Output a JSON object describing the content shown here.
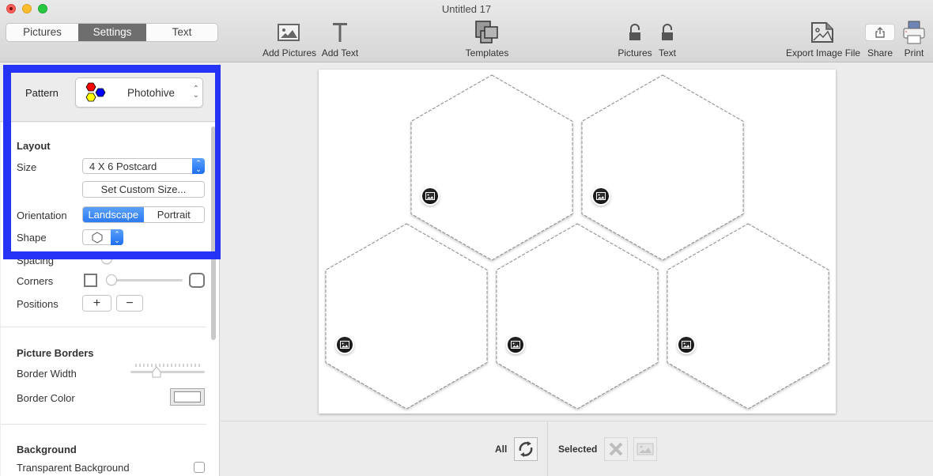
{
  "window": {
    "title": "Untitled 17"
  },
  "mode_tabs": [
    {
      "label": "Pictures",
      "active": false
    },
    {
      "label": "Settings",
      "active": true
    },
    {
      "label": "Text",
      "active": false
    }
  ],
  "toolbar": {
    "add_pictures": "Add Pictures",
    "add_text": "Add Text",
    "templates": "Templates",
    "lock_pictures": "Pictures",
    "lock_text": "Text",
    "export": "Export Image File",
    "share": "Share",
    "print": "Print"
  },
  "sidebar": {
    "pattern": {
      "label": "Pattern",
      "value": "Photohive",
      "icon_colors": [
        "#ff0000",
        "#ffff00",
        "#0000ff"
      ]
    },
    "layout": {
      "title": "Layout",
      "size_label": "Size",
      "size_value": "4 X 6 Postcard",
      "custom_size_button": "Set Custom Size...",
      "orientation_label": "Orientation",
      "orientation_options": [
        "Landscape",
        "Portrait"
      ],
      "orientation_selected": "Landscape",
      "shape_label": "Shape",
      "shape_value": "hexagon",
      "spacing_label": "Spacing",
      "corners_label": "Corners",
      "corners_value": 0,
      "positions_label": "Positions",
      "positions_add": "+",
      "positions_remove": "−"
    },
    "picture_borders": {
      "title": "Picture Borders",
      "border_width_label": "Border Width",
      "border_width_value": 0.25,
      "border_color_label": "Border Color",
      "border_color": "#ffffff"
    },
    "background": {
      "title": "Background",
      "transparent_label": "Transparent Background",
      "transparent_checked": false
    }
  },
  "canvas": {
    "cells": [
      {
        "id": 1,
        "row": 1
      },
      {
        "id": 2,
        "row": 1
      },
      {
        "id": 3,
        "row": 2
      },
      {
        "id": 4,
        "row": 2
      },
      {
        "id": 5,
        "row": 2
      }
    ]
  },
  "bottom_bar": {
    "all_label": "All",
    "selected_label": "Selected"
  },
  "highlight_color": "#2433f5"
}
